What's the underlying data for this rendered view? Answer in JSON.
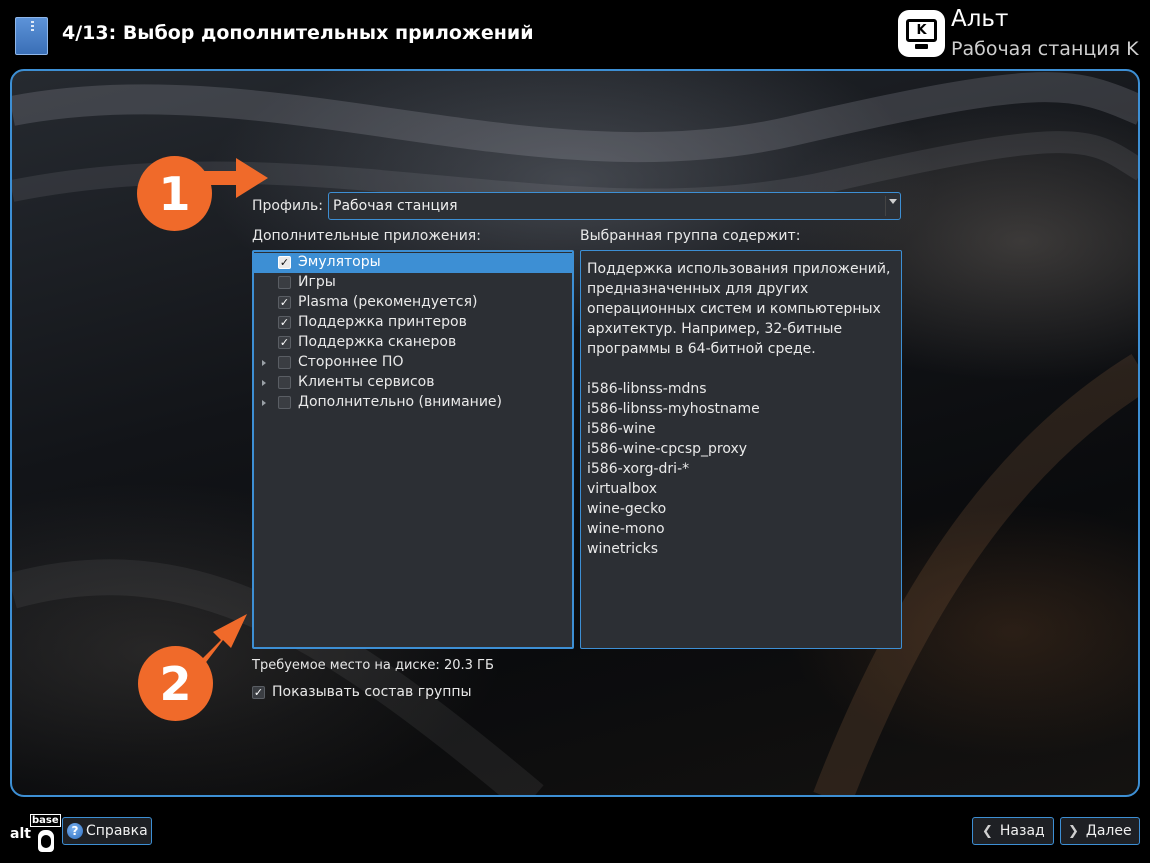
{
  "header": {
    "step_title": "4/13: Выбор дополнительных приложений",
    "brand_name": "Альт",
    "brand_subtitle": "Рабочая станция K",
    "logo_letter": "K"
  },
  "profile": {
    "label": "Профиль:",
    "value": "Рабочая станция"
  },
  "apps": {
    "label": "Дополнительные приложения:",
    "items": [
      {
        "label": "Эмуляторы",
        "checked": true,
        "selected": true,
        "expandable": false
      },
      {
        "label": "Игры",
        "checked": false,
        "selected": false,
        "expandable": false
      },
      {
        "label": "Plasma (рекомендуется)",
        "checked": true,
        "selected": false,
        "expandable": false
      },
      {
        "label": "Поддержка принтеров",
        "checked": true,
        "selected": false,
        "expandable": false
      },
      {
        "label": "Поддержка сканеров",
        "checked": true,
        "selected": false,
        "expandable": false
      },
      {
        "label": "Стороннее ПО",
        "checked": false,
        "selected": false,
        "expandable": true
      },
      {
        "label": "Клиенты сервисов",
        "checked": false,
        "selected": false,
        "expandable": true
      },
      {
        "label": "Дополнительно (внимание)",
        "checked": false,
        "selected": false,
        "expandable": true
      }
    ]
  },
  "group": {
    "label": "Выбранная группа содержит:",
    "description": "Поддержка использования приложений, предназначенных для других операционных систем и компьютерных архитектур. Например, 32-битные программы в 64-битной среде.",
    "description_lines": [
      "Поддержка использования приложений,",
      "предназначенных для других",
      "операционных систем и компьютерных",
      "архитектур. Например, 32-битные",
      "программы в 64-битной среде."
    ],
    "packages": [
      "i586-libnss-mdns",
      "i586-libnss-myhostname",
      "i586-wine",
      "i586-wine-cpcsp_proxy",
      "i586-xorg-dri-*",
      "virtualbox",
      "wine-gecko",
      "wine-mono",
      "winetricks"
    ]
  },
  "disk_space": "Требуемое место на диске: 20.3 ГБ",
  "show_group": {
    "label": "Показывать состав группы",
    "checked": true
  },
  "annotations": {
    "badge_1": "1",
    "badge_2": "2",
    "color": "#f06a2a"
  },
  "footer": {
    "logo_base": "base",
    "logo_alt": "alt",
    "help_label": "Справка",
    "back_label": "Назад",
    "next_label": "Далее"
  },
  "colors": {
    "accent": "#3d8fd4",
    "selection": "#3d8fd4",
    "panel_bg": "#2c2f34"
  }
}
